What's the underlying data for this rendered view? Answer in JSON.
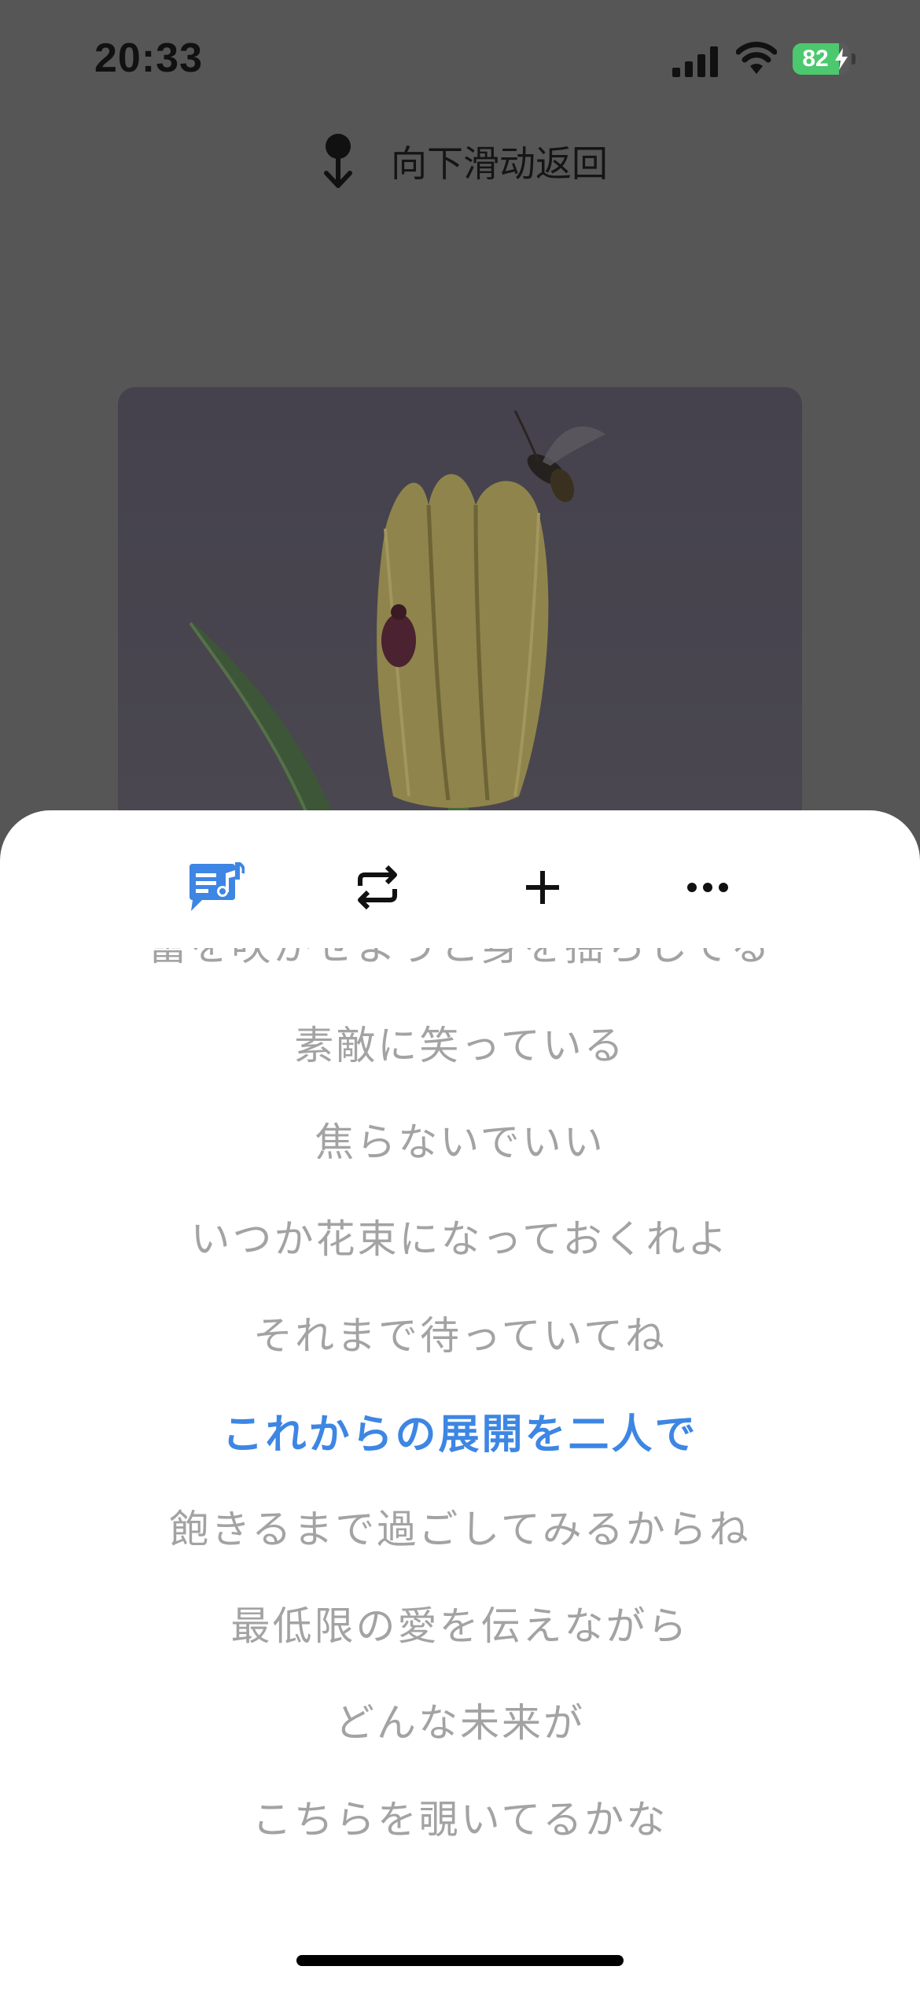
{
  "status_bar": {
    "time": "20:33",
    "battery_percent": 82,
    "battery_label": "82",
    "battery_charging": true
  },
  "swipe_hint": {
    "text": "向下滑动返回",
    "icon": "pin-down-arrow-icon"
  },
  "album_art": {
    "description_icon": "album-cover-image"
  },
  "toolbar": {
    "items": [
      {
        "icon": "lyrics-icon",
        "active": true
      },
      {
        "icon": "repeat-icon",
        "active": false
      },
      {
        "icon": "add-icon",
        "active": false
      },
      {
        "icon": "more-icon",
        "active": false
      }
    ]
  },
  "lyrics": {
    "lines": [
      "蕾を咲かせようと身を揺らしてる",
      "素敵に笑っている",
      "焦らないでいい",
      "いつか花束になっておくれよ",
      "それまで待っていてね",
      "これからの展開を二人で",
      "飽きるまで過ごしてみるからね",
      "最低限の愛を伝えながら",
      "どんな未来が",
      "こちらを覗いてるかな"
    ],
    "current_index": 5
  },
  "colors": {
    "accent": "#3d86e3",
    "lyric_inactive": "#a3a3a3",
    "battery_green": "#4cc86e",
    "overlay_background": "#565656"
  }
}
